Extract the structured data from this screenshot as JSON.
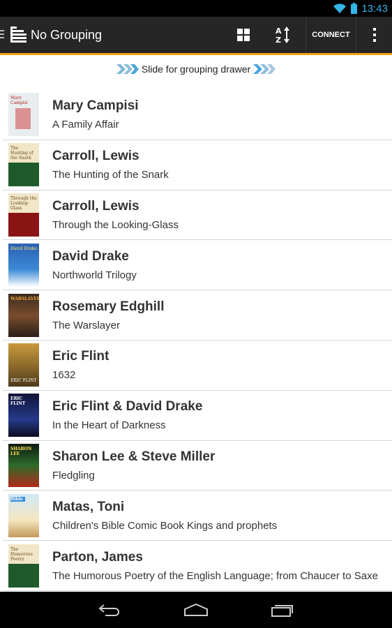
{
  "status": {
    "time": "13:43"
  },
  "action_bar": {
    "title": "No Grouping",
    "connect_label": "CONNECT"
  },
  "drawer_hint": "Slide for grouping drawer",
  "books": [
    {
      "author": "Mary Campisi",
      "title": "A Family Affair",
      "cover_text": "Mary Campisi"
    },
    {
      "author": "Carroll, Lewis",
      "title": "The Hunting of the Snark",
      "cover_text": "The Hunting of the Snark"
    },
    {
      "author": "Carroll, Lewis",
      "title": "Through the Looking-Glass",
      "cover_text": "Through the Looking-Glass"
    },
    {
      "author": "David Drake",
      "title": "Northworld Trilogy",
      "cover_text": "David Drake"
    },
    {
      "author": "Rosemary Edghill",
      "title": "The Warslayer",
      "cover_text": "WARSLAYER"
    },
    {
      "author": "Eric Flint",
      "title": "1632",
      "cover_text": "ERIC FLINT"
    },
    {
      "author": "Eric Flint & David Drake",
      "title": "In the Heart of Darkness",
      "cover_text": "ERIC FLINT"
    },
    {
      "author": "Sharon Lee & Steve Miller",
      "title": "Fledgling",
      "cover_text": "SHARON LEE"
    },
    {
      "author": "Matas, Toni",
      "title": "Children's Bible Comic Book Kings and prophets",
      "cover_text": "Bible"
    },
    {
      "author": "Parton, James",
      "title": "The Humorous Poetry of the English Language; from Chaucer to Saxe",
      "cover_text": "The Humorous Poetry"
    }
  ],
  "colors": {
    "accent_orange": "#f4a21b",
    "status_blue": "#33b5e5",
    "action_bar_bg": "#262626",
    "hint_chevron": "#33b5e5"
  }
}
